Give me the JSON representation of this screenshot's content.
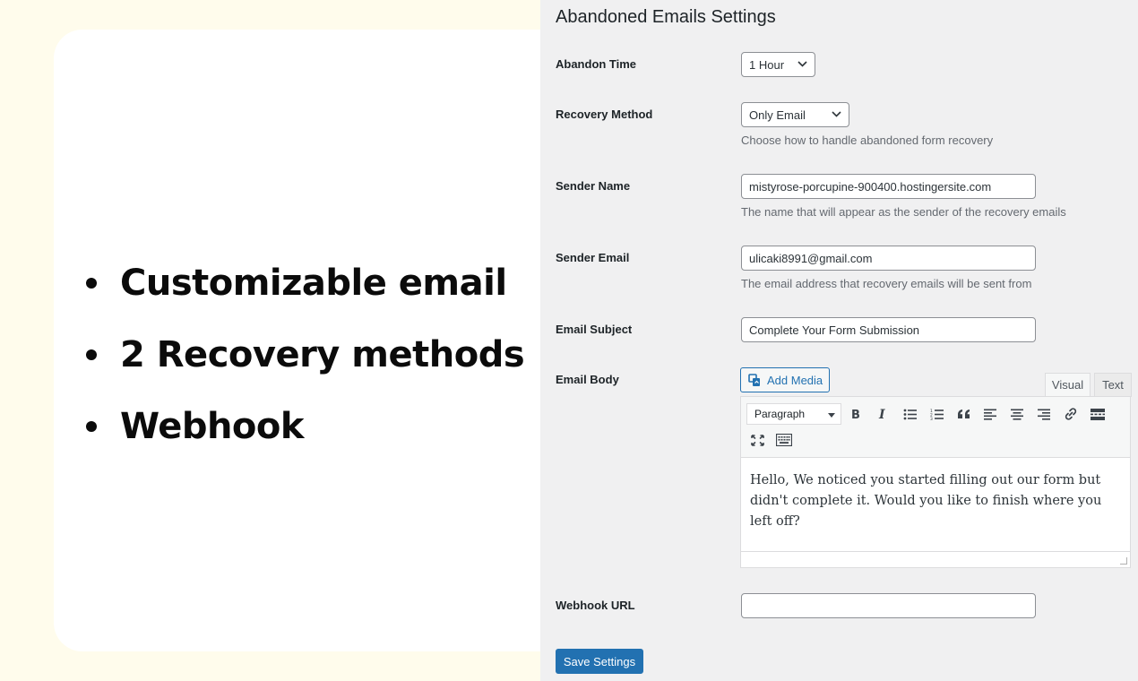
{
  "promo": {
    "features": [
      "Customizable email",
      "2 Recovery methods",
      "Webhook"
    ]
  },
  "settings": {
    "title": "Abandoned Emails Settings",
    "abandon_time": {
      "label": "Abandon Time",
      "value": "1 Hour"
    },
    "recovery_method": {
      "label": "Recovery Method",
      "value": "Only Email",
      "description": "Choose how to handle abandoned form recovery"
    },
    "sender_name": {
      "label": "Sender Name",
      "value": "mistyrose-porcupine-900400.hostingersite.com",
      "description": "The name that will appear as the sender of the recovery emails"
    },
    "sender_email": {
      "label": "Sender Email",
      "value": "ulicaki8991@gmail.com",
      "description": "The email address that recovery emails will be sent from"
    },
    "email_subject": {
      "label": "Email Subject",
      "value": "Complete Your Form Submission"
    },
    "email_body": {
      "label": "Email Body",
      "add_media": "Add Media",
      "tab_visual": "Visual",
      "tab_text": "Text",
      "format": "Paragraph",
      "content": "Hello, We noticed you started filling out our form but didn't complete it. Would you like to finish where you left off?"
    },
    "webhook_url": {
      "label": "Webhook URL",
      "value": ""
    },
    "save_label": "Save Settings"
  },
  "colors": {
    "primary": "#2271b1",
    "panel_bg": "#f0f0f1",
    "page_bg": "#fffcec"
  },
  "icons": [
    "chevron-down-icon",
    "add-media-icon",
    "bold-icon",
    "italic-icon",
    "bullet-list-icon",
    "numbered-list-icon",
    "blockquote-icon",
    "align-left-icon",
    "align-center-icon",
    "align-right-icon",
    "link-icon",
    "read-more-icon",
    "fullscreen-icon",
    "keyboard-icon"
  ]
}
